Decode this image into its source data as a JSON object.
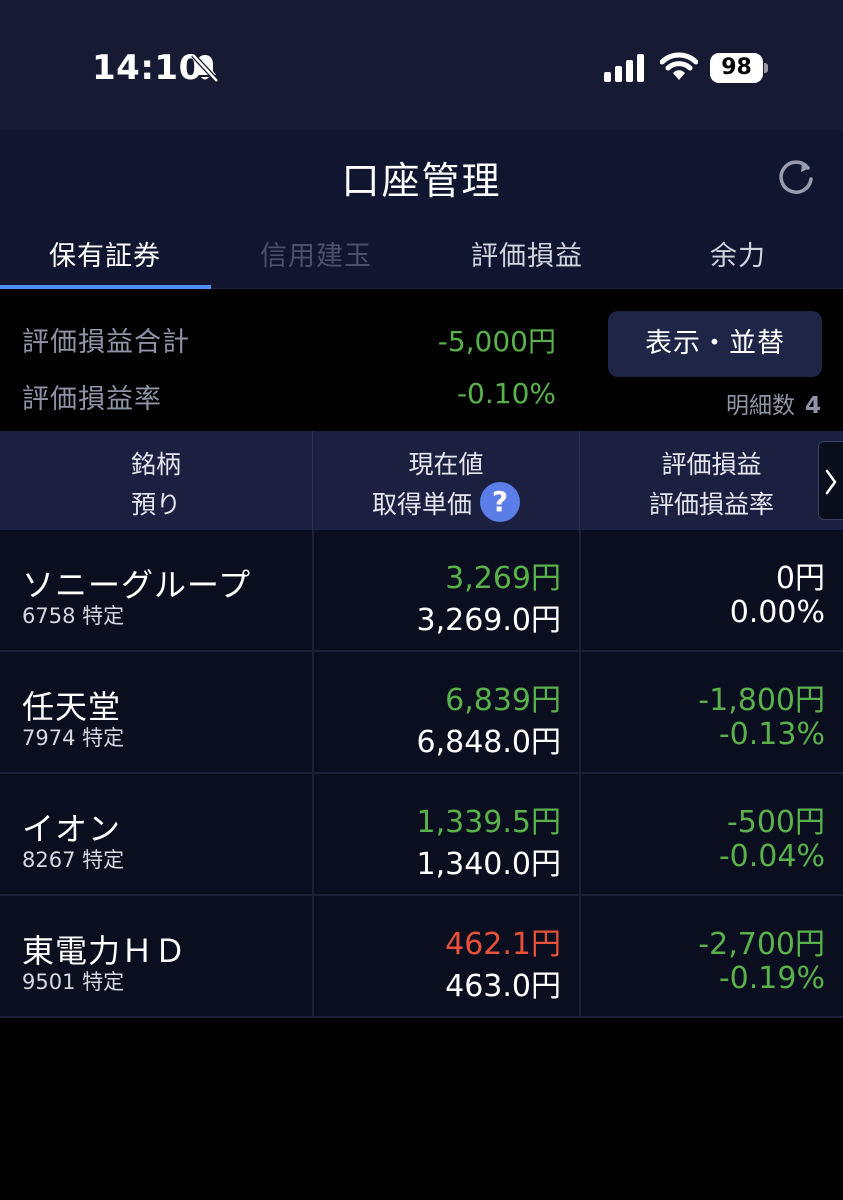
{
  "status_bar": {
    "time": "14:10",
    "battery_level": "98",
    "icons": [
      "bell-slash-icon",
      "cellular-signal-icon",
      "wifi-icon",
      "battery-icon"
    ]
  },
  "header": {
    "title": "口座管理",
    "refresh_icon": "refresh-icon"
  },
  "tabs": [
    {
      "label": "保有証券",
      "active": true
    },
    {
      "label": "信用建玉",
      "active": false
    },
    {
      "label": "評価損益",
      "active": false
    },
    {
      "label": "余力",
      "active": false
    }
  ],
  "summary": {
    "total_label": "評価損益合計",
    "total_value": "-5,000円",
    "rate_label": "評価損益率",
    "rate_value": "-0.10%",
    "display_button_label": "表示・並替",
    "detail_count_label": "明細数",
    "detail_count_value": "4"
  },
  "table_header": {
    "col1_line1": "銘柄",
    "col1_line2": "預り",
    "col2_line1": "現在値",
    "col2_line2": "取得単価",
    "help_icon": "?",
    "col3_line1": "評価損益",
    "col3_line2": "評価損益率"
  },
  "colors": {
    "positive_green": "#58b14a",
    "negative_red": "#e8503a",
    "accent_blue": "#4f8ef7"
  },
  "holdings": [
    {
      "name": "ソニーグループ",
      "code": "6758 特定",
      "current_price": "3,269円",
      "current_color": "#58b14a",
      "acquisition_price": "3,269.0円",
      "pl": "0円",
      "pl_rate": "0.00%",
      "pl_color": "#ffffff"
    },
    {
      "name": "任天堂",
      "code": "7974 特定",
      "current_price": "6,839円",
      "current_color": "#58b14a",
      "acquisition_price": "6,848.0円",
      "pl": "-1,800円",
      "pl_rate": "-0.13%",
      "pl_color": "#58b14a"
    },
    {
      "name": "イオン",
      "code": "8267 特定",
      "current_price": "1,339.5円",
      "current_color": "#58b14a",
      "acquisition_price": "1,340.0円",
      "pl": "-500円",
      "pl_rate": "-0.04%",
      "pl_color": "#58b14a"
    },
    {
      "name": "東電力ＨＤ",
      "code": "9501 特定",
      "current_price": "462.1円",
      "current_color": "#e8503a",
      "acquisition_price": "463.0円",
      "pl": "-2,700円",
      "pl_rate": "-0.19%",
      "pl_color": "#58b14a"
    }
  ]
}
